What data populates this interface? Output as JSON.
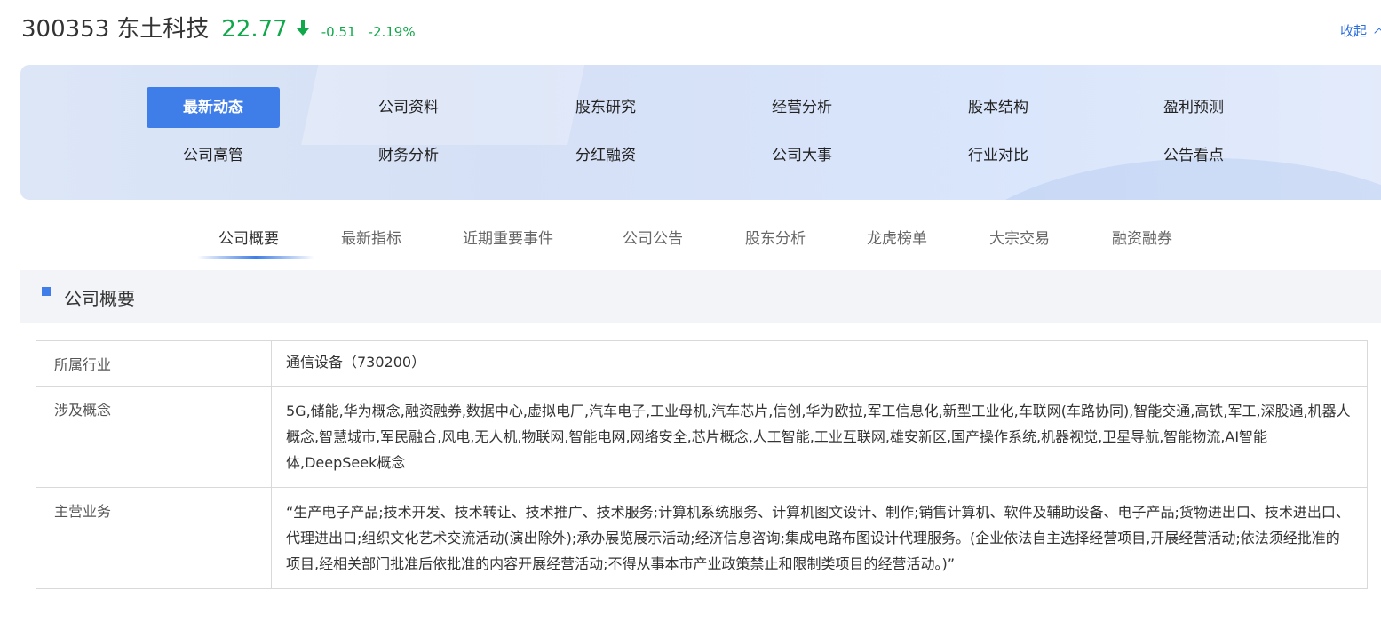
{
  "header": {
    "code": "300353",
    "name": "东土科技",
    "price": "22.77",
    "change": "-0.51",
    "change_pct": "-2.19%",
    "collapse_label": "收起",
    "price_color": "#11a84b",
    "direction_icon": "arrow-down-icon"
  },
  "nav": {
    "items": [
      {
        "label": "最新动态"
      },
      {
        "label": "公司资料"
      },
      {
        "label": "股东研究"
      },
      {
        "label": "经营分析"
      },
      {
        "label": "股本结构"
      },
      {
        "label": "盈利预测"
      },
      {
        "label": "公司高管"
      },
      {
        "label": "财务分析"
      },
      {
        "label": "分红融资"
      },
      {
        "label": "公司大事"
      },
      {
        "label": "行业对比"
      },
      {
        "label": "公告看点"
      }
    ],
    "active_label": "最新动态"
  },
  "subtabs": {
    "items": [
      {
        "label": "公司概要"
      },
      {
        "label": "最新指标"
      },
      {
        "label": "近期重要事件"
      },
      {
        "label": "公司公告"
      },
      {
        "label": "股东分析"
      },
      {
        "label": "龙虎榜单"
      },
      {
        "label": "大宗交易"
      },
      {
        "label": "融资融券"
      }
    ],
    "active_label": "公司概要"
  },
  "section": {
    "title": "公司概要"
  },
  "table": {
    "rows": [
      {
        "key": "所属行业",
        "value": "通信设备（730200）"
      },
      {
        "key": "涉及概念",
        "value": "5G,储能,华为概念,融资融券,数据中心,虚拟电厂,汽车电子,工业母机,汽车芯片,信创,华为欧拉,军工信息化,新型工业化,车联网(车路协同),智能交通,高铁,军工,深股通,机器人概念,智慧城市,军民融合,风电,无人机,物联网,智能电网,网络安全,芯片概念,人工智能,工业互联网,雄安新区,国产操作系统,机器视觉,卫星导航,智能物流,AI智能体,DeepSeek概念"
      },
      {
        "key": "主营业务",
        "value": "“生产电子产品;技术开发、技术转让、技术推广、技术服务;计算机系统服务、计算机图文设计、制作;销售计算机、软件及辅助设备、电子产品;货物进出口、技术进出口、代理进出口;组织文化艺术交流活动(演出除外);承办展览展示活动;经济信息咨询;集成电路布图设计代理服务。(企业依法自主选择经营项目,开展经营活动;依法须经批准的项目,经相关部门批准后依批准的内容开展经营活动;不得从事本市产业政策禁止和限制类项目的经营活动。)”"
      }
    ]
  },
  "colors": {
    "accent": "#3f7de8",
    "down": "#11a84b",
    "link": "#2e6fde"
  }
}
